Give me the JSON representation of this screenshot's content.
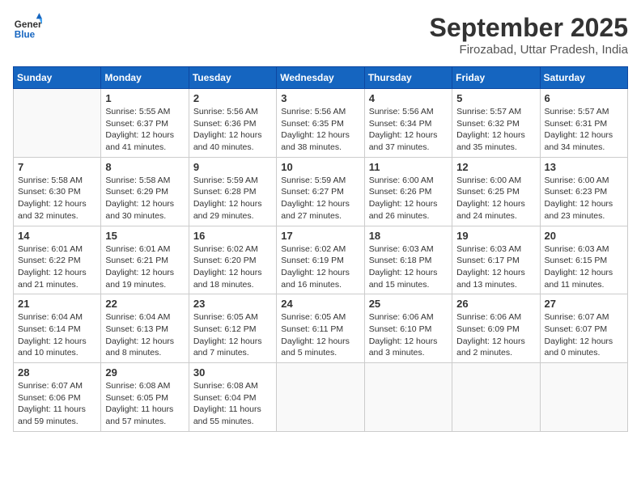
{
  "header": {
    "logo_line1": "General",
    "logo_line2": "Blue",
    "month": "September 2025",
    "location": "Firozabad, Uttar Pradesh, India"
  },
  "weekdays": [
    "Sunday",
    "Monday",
    "Tuesday",
    "Wednesday",
    "Thursday",
    "Friday",
    "Saturday"
  ],
  "weeks": [
    [
      {
        "day": "",
        "info": ""
      },
      {
        "day": "1",
        "info": "Sunrise: 5:55 AM\nSunset: 6:37 PM\nDaylight: 12 hours\nand 41 minutes."
      },
      {
        "day": "2",
        "info": "Sunrise: 5:56 AM\nSunset: 6:36 PM\nDaylight: 12 hours\nand 40 minutes."
      },
      {
        "day": "3",
        "info": "Sunrise: 5:56 AM\nSunset: 6:35 PM\nDaylight: 12 hours\nand 38 minutes."
      },
      {
        "day": "4",
        "info": "Sunrise: 5:56 AM\nSunset: 6:34 PM\nDaylight: 12 hours\nand 37 minutes."
      },
      {
        "day": "5",
        "info": "Sunrise: 5:57 AM\nSunset: 6:32 PM\nDaylight: 12 hours\nand 35 minutes."
      },
      {
        "day": "6",
        "info": "Sunrise: 5:57 AM\nSunset: 6:31 PM\nDaylight: 12 hours\nand 34 minutes."
      }
    ],
    [
      {
        "day": "7",
        "info": "Sunrise: 5:58 AM\nSunset: 6:30 PM\nDaylight: 12 hours\nand 32 minutes."
      },
      {
        "day": "8",
        "info": "Sunrise: 5:58 AM\nSunset: 6:29 PM\nDaylight: 12 hours\nand 30 minutes."
      },
      {
        "day": "9",
        "info": "Sunrise: 5:59 AM\nSunset: 6:28 PM\nDaylight: 12 hours\nand 29 minutes."
      },
      {
        "day": "10",
        "info": "Sunrise: 5:59 AM\nSunset: 6:27 PM\nDaylight: 12 hours\nand 27 minutes."
      },
      {
        "day": "11",
        "info": "Sunrise: 6:00 AM\nSunset: 6:26 PM\nDaylight: 12 hours\nand 26 minutes."
      },
      {
        "day": "12",
        "info": "Sunrise: 6:00 AM\nSunset: 6:25 PM\nDaylight: 12 hours\nand 24 minutes."
      },
      {
        "day": "13",
        "info": "Sunrise: 6:00 AM\nSunset: 6:23 PM\nDaylight: 12 hours\nand 23 minutes."
      }
    ],
    [
      {
        "day": "14",
        "info": "Sunrise: 6:01 AM\nSunset: 6:22 PM\nDaylight: 12 hours\nand 21 minutes."
      },
      {
        "day": "15",
        "info": "Sunrise: 6:01 AM\nSunset: 6:21 PM\nDaylight: 12 hours\nand 19 minutes."
      },
      {
        "day": "16",
        "info": "Sunrise: 6:02 AM\nSunset: 6:20 PM\nDaylight: 12 hours\nand 18 minutes."
      },
      {
        "day": "17",
        "info": "Sunrise: 6:02 AM\nSunset: 6:19 PM\nDaylight: 12 hours\nand 16 minutes."
      },
      {
        "day": "18",
        "info": "Sunrise: 6:03 AM\nSunset: 6:18 PM\nDaylight: 12 hours\nand 15 minutes."
      },
      {
        "day": "19",
        "info": "Sunrise: 6:03 AM\nSunset: 6:17 PM\nDaylight: 12 hours\nand 13 minutes."
      },
      {
        "day": "20",
        "info": "Sunrise: 6:03 AM\nSunset: 6:15 PM\nDaylight: 12 hours\nand 11 minutes."
      }
    ],
    [
      {
        "day": "21",
        "info": "Sunrise: 6:04 AM\nSunset: 6:14 PM\nDaylight: 12 hours\nand 10 minutes."
      },
      {
        "day": "22",
        "info": "Sunrise: 6:04 AM\nSunset: 6:13 PM\nDaylight: 12 hours\nand 8 minutes."
      },
      {
        "day": "23",
        "info": "Sunrise: 6:05 AM\nSunset: 6:12 PM\nDaylight: 12 hours\nand 7 minutes."
      },
      {
        "day": "24",
        "info": "Sunrise: 6:05 AM\nSunset: 6:11 PM\nDaylight: 12 hours\nand 5 minutes."
      },
      {
        "day": "25",
        "info": "Sunrise: 6:06 AM\nSunset: 6:10 PM\nDaylight: 12 hours\nand 3 minutes."
      },
      {
        "day": "26",
        "info": "Sunrise: 6:06 AM\nSunset: 6:09 PM\nDaylight: 12 hours\nand 2 minutes."
      },
      {
        "day": "27",
        "info": "Sunrise: 6:07 AM\nSunset: 6:07 PM\nDaylight: 12 hours\nand 0 minutes."
      }
    ],
    [
      {
        "day": "28",
        "info": "Sunrise: 6:07 AM\nSunset: 6:06 PM\nDaylight: 11 hours\nand 59 minutes."
      },
      {
        "day": "29",
        "info": "Sunrise: 6:08 AM\nSunset: 6:05 PM\nDaylight: 11 hours\nand 57 minutes."
      },
      {
        "day": "30",
        "info": "Sunrise: 6:08 AM\nSunset: 6:04 PM\nDaylight: 11 hours\nand 55 minutes."
      },
      {
        "day": "",
        "info": ""
      },
      {
        "day": "",
        "info": ""
      },
      {
        "day": "",
        "info": ""
      },
      {
        "day": "",
        "info": ""
      }
    ]
  ]
}
